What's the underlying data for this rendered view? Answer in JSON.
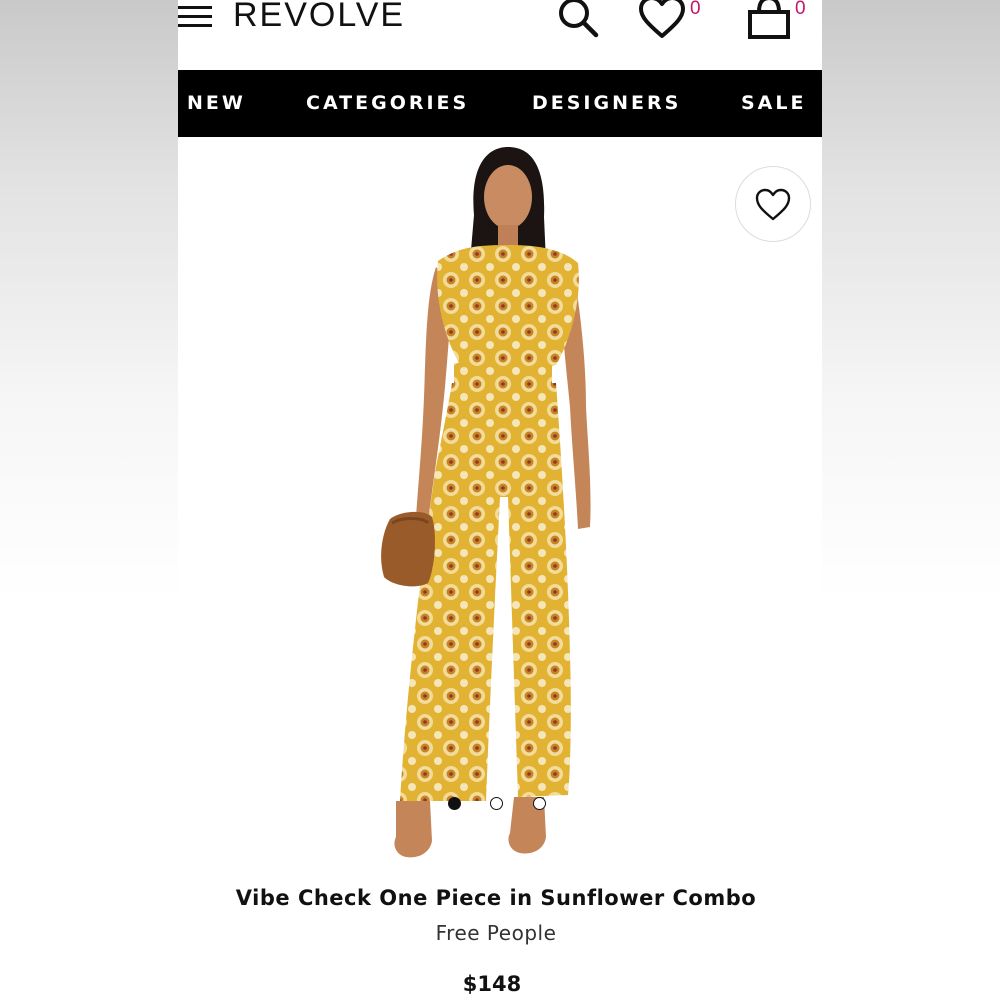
{
  "header": {
    "logo": "REVOLVE",
    "wishlist_count": "0",
    "bag_count": "0",
    "icons": [
      "menu-icon",
      "search-icon",
      "heart-icon",
      "bag-icon"
    ],
    "accent_color": "#c2186a"
  },
  "nav": {
    "items": [
      "NEW",
      "CATEGORIES",
      "DESIGNERS",
      "SALE"
    ]
  },
  "product": {
    "name": "Vibe Check One Piece in Sunflower Combo",
    "brand": "Free People",
    "price": "$148",
    "image_count": 3,
    "active_image": 1
  }
}
